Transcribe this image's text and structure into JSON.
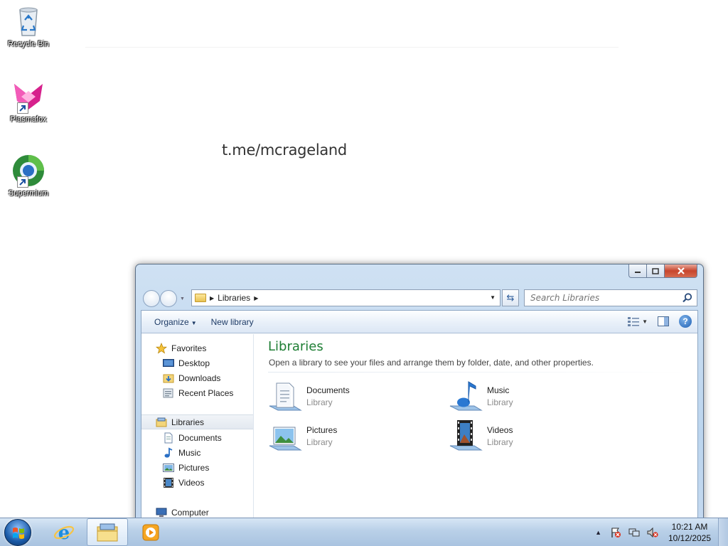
{
  "desktop": {
    "wallpaper_text": "t.me/mcrageland",
    "icons": [
      {
        "label": "Recycle Bin"
      },
      {
        "label": "Plasmafox"
      },
      {
        "label": "Supermium"
      }
    ]
  },
  "window": {
    "address": {
      "crumbs": [
        "Libraries"
      ]
    },
    "search": {
      "placeholder": "Search Libraries"
    },
    "toolbar": {
      "organize_label": "Organize",
      "new_library_label": "New library"
    },
    "nav": {
      "favorites": {
        "label": "Favorites",
        "items": [
          "Desktop",
          "Downloads",
          "Recent Places"
        ]
      },
      "libraries": {
        "label": "Libraries",
        "items": [
          "Documents",
          "Music",
          "Pictures",
          "Videos"
        ]
      },
      "computer": {
        "label": "Computer"
      }
    },
    "content": {
      "title": "Libraries",
      "description": "Open a library to see your files and arrange them by folder, date, and other properties.",
      "libraries": [
        {
          "name": "Documents",
          "type": "Library"
        },
        {
          "name": "Music",
          "type": "Library"
        },
        {
          "name": "Pictures",
          "type": "Library"
        },
        {
          "name": "Videos",
          "type": "Library"
        }
      ]
    }
  },
  "taskbar": {
    "clock": {
      "time": "10:21 AM",
      "date": "10/12/2025"
    }
  },
  "colors": {
    "title_green": "#1e7e34",
    "toolbar_text": "#1e3b66",
    "taskbar_blue": "#b9d0e8"
  }
}
